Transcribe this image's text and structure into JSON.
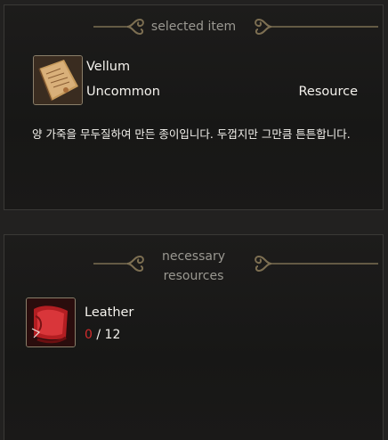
{
  "selected_panel": {
    "title": "selected item",
    "item": {
      "name": "Vellum",
      "rarity": "Uncommon",
      "category": "Resource",
      "icon": "vellum-scroll-icon",
      "description": "양 가죽을 무두질하여 만든 종이입니다. 두껍지만 그만큼 튼튼합니다."
    }
  },
  "resources_panel": {
    "title_line1": "necessary",
    "title_line2": "resources",
    "items": [
      {
        "name": "Leather",
        "icon": "leather-hide-icon",
        "current": "0",
        "separator": " / ",
        "required": "12"
      }
    ]
  },
  "colors": {
    "background": "#222120",
    "panel": "#1a1918",
    "title_text": "#9a9891",
    "ornament": "#7d6f52",
    "insufficient": "#d42c2c",
    "text": "#f4f2ed"
  }
}
